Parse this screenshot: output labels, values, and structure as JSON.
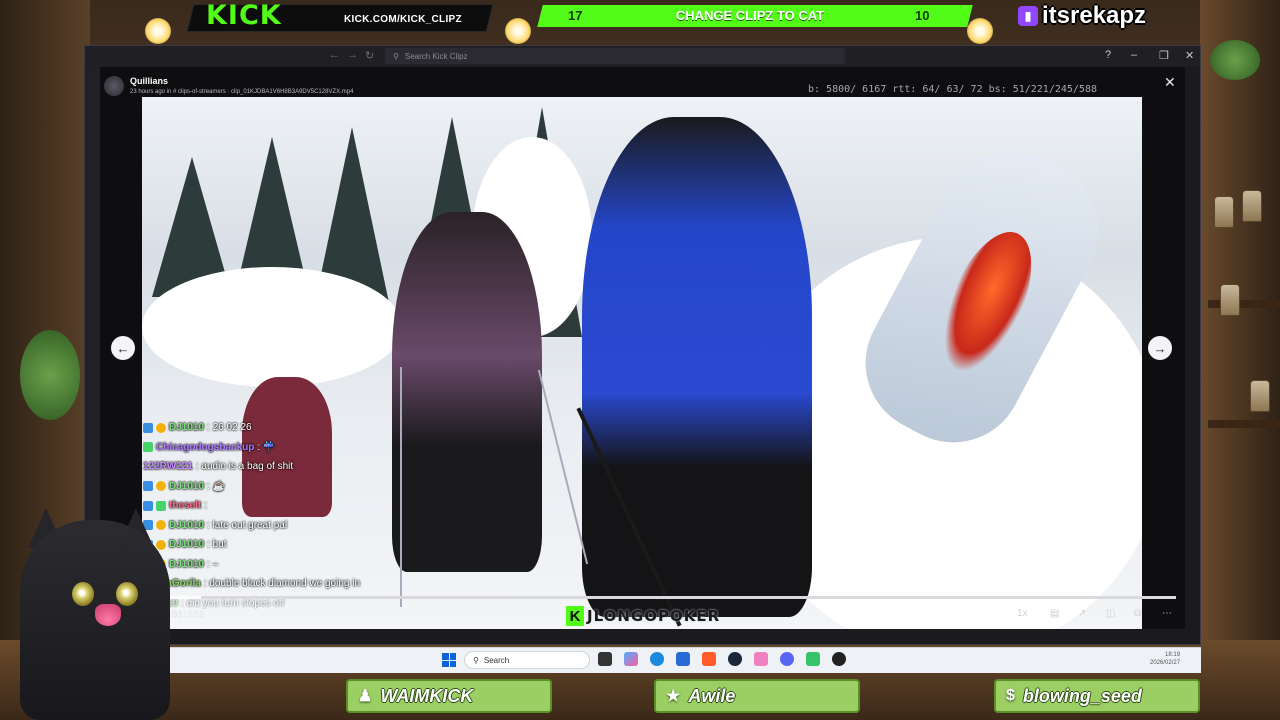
{
  "overlay": {
    "kick_logo": "KICK",
    "kick_url": "KICK.COM/KICK_CLIPZ",
    "poll": {
      "left_count": "17",
      "title": "CHANGE CLIPZ TO CAT",
      "right_count": "10"
    },
    "twitch_name": "itsrekapz"
  },
  "window": {
    "search_placeholder": "Search Kick Clipz"
  },
  "viewer": {
    "uploader": "Quillians",
    "meta": "23 hours ago in # clips-of-streamers · clip_01KJDBA1V6H8B3A9DV5C128VZX.mp4",
    "stats": "b:  5800/ 6167  rtt:  64/ 63/ 72  bs:  51/221/245/588"
  },
  "chat": [
    {
      "user": "DJ1010",
      "message": ": 26 02 26",
      "user_color": "#7fe07f",
      "badges": [
        "blue",
        "gold"
      ]
    },
    {
      "user": "Chicagodogsbackup",
      "message": " : ☔",
      "user_color": "#b07aff",
      "badges": [
        "green"
      ]
    },
    {
      "user": "122RW221",
      "message": " : audio is a bag of shit",
      "user_color": "#c68cff",
      "badges": []
    },
    {
      "user": "DJ1010",
      "message": " : ☕",
      "user_color": "#7fe07f",
      "badges": [
        "blue",
        "gold"
      ]
    },
    {
      "user": "theselt",
      "message": " :",
      "user_color": "#ff6a8a",
      "badges": [
        "blue",
        "green"
      ]
    },
    {
      "user": "DJ1010",
      "message": " : late out great pal",
      "user_color": "#7fe07f",
      "badges": [
        "blue",
        "gold"
      ]
    },
    {
      "user": "DJ1010",
      "message": " : but",
      "user_color": "#7fe07f",
      "badges": [
        "blue",
        "gold"
      ]
    },
    {
      "user": "DJ1010",
      "message": " : –",
      "user_color": "#7fe07f",
      "badges": [
        "blue",
        "gold"
      ]
    },
    {
      "user": "VanilaGorila",
      "message": " : double black diamond we going in",
      "user_color": "#8ad66a",
      "badges": []
    },
    {
      "user": "DJ1010",
      "message": " : did you turn slopes off",
      "user_color": "#7fe07f",
      "badges": [],
      "faded": true
    }
  ],
  "player": {
    "time": "0:03 / 0:59",
    "progress_fraction": 0.05,
    "speed": "1x",
    "watermark": "JLONGOPOKER"
  },
  "taskbar": {
    "search_label": "Search",
    "clock_time": "18:19",
    "clock_date": "2026/02/27"
  },
  "plates": [
    {
      "label": "WAIMKICK",
      "icon": "person"
    },
    {
      "label": "Awile",
      "icon": "star"
    },
    {
      "label": "blowing_seed",
      "icon": "dollar"
    }
  ]
}
